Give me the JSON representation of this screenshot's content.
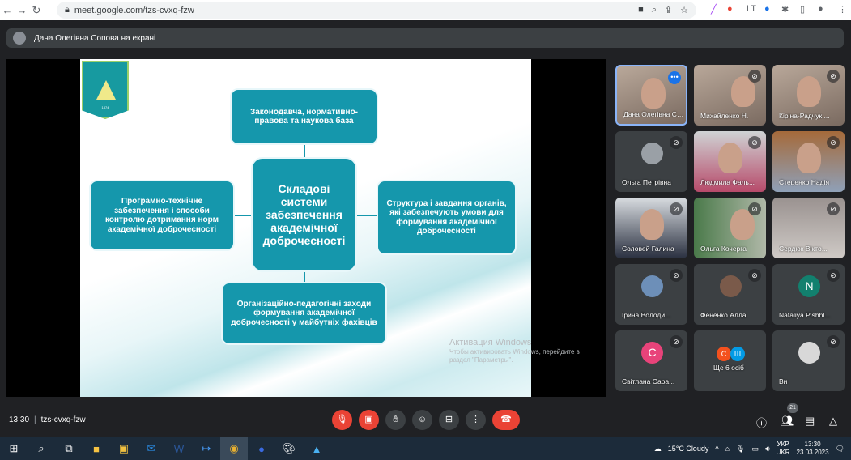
{
  "browser": {
    "url": "meet.google.com/tzs-cvxq-fzw"
  },
  "banner": {
    "text": "Дана Олегівна Сопова на екрані"
  },
  "slide": {
    "logo_text": "Київський університет імені Бориса Грінченка",
    "logo_year": "1874",
    "center": "Складові системи забезпечення академічної доброчесності",
    "top": "Законодавча, нормативно-правова та наукова база",
    "left": "Програмно-технічне забезпечення і способи контролю дотримання норм академічної доброчесності",
    "right": "Структура і завдання органів, які забезпечують умови для формування академічної доброчесності",
    "bottom": "Організаційно-педагогічні заходи формування академічної доброчесності у майбутніх фахівців"
  },
  "watermark": {
    "title": "Активация Windows",
    "line1": "Чтобы активировать Windows, перейдите в",
    "line2": "раздел \"Параметры\"."
  },
  "participants": [
    {
      "name": "Дана Олегівна Сопова"
    },
    {
      "name": "Михайленко Н."
    },
    {
      "name": "Кіріна-Радчук ..."
    },
    {
      "name": "Ольга Петрівна"
    },
    {
      "name": "Людмила Фаль..."
    },
    {
      "name": "Стеценко Надія"
    },
    {
      "name": "Соловей Галина"
    },
    {
      "name": "Ольга Кочерга"
    },
    {
      "name": "Сердюк Вікто..."
    },
    {
      "name": "Ірина Володи...",
      "initial": ""
    },
    {
      "name": "Фененко Алла"
    },
    {
      "name": "Nataliya Pishhl...",
      "initial": "N"
    },
    {
      "name": "Світлана Сара...",
      "initial": "С"
    },
    {
      "name": "Ще 6 осіб",
      "initials": [
        "С",
        "Ш"
      ]
    },
    {
      "name": "Ви"
    }
  ],
  "meeting": {
    "time": "13:30",
    "code": "tzs-cvxq-fzw",
    "people_count": "21"
  },
  "taskbar": {
    "weather": "15°C  Cloudy",
    "lang1": "УКР",
    "lang2": "UKR",
    "time": "13:30",
    "date": "23.03.2023"
  }
}
